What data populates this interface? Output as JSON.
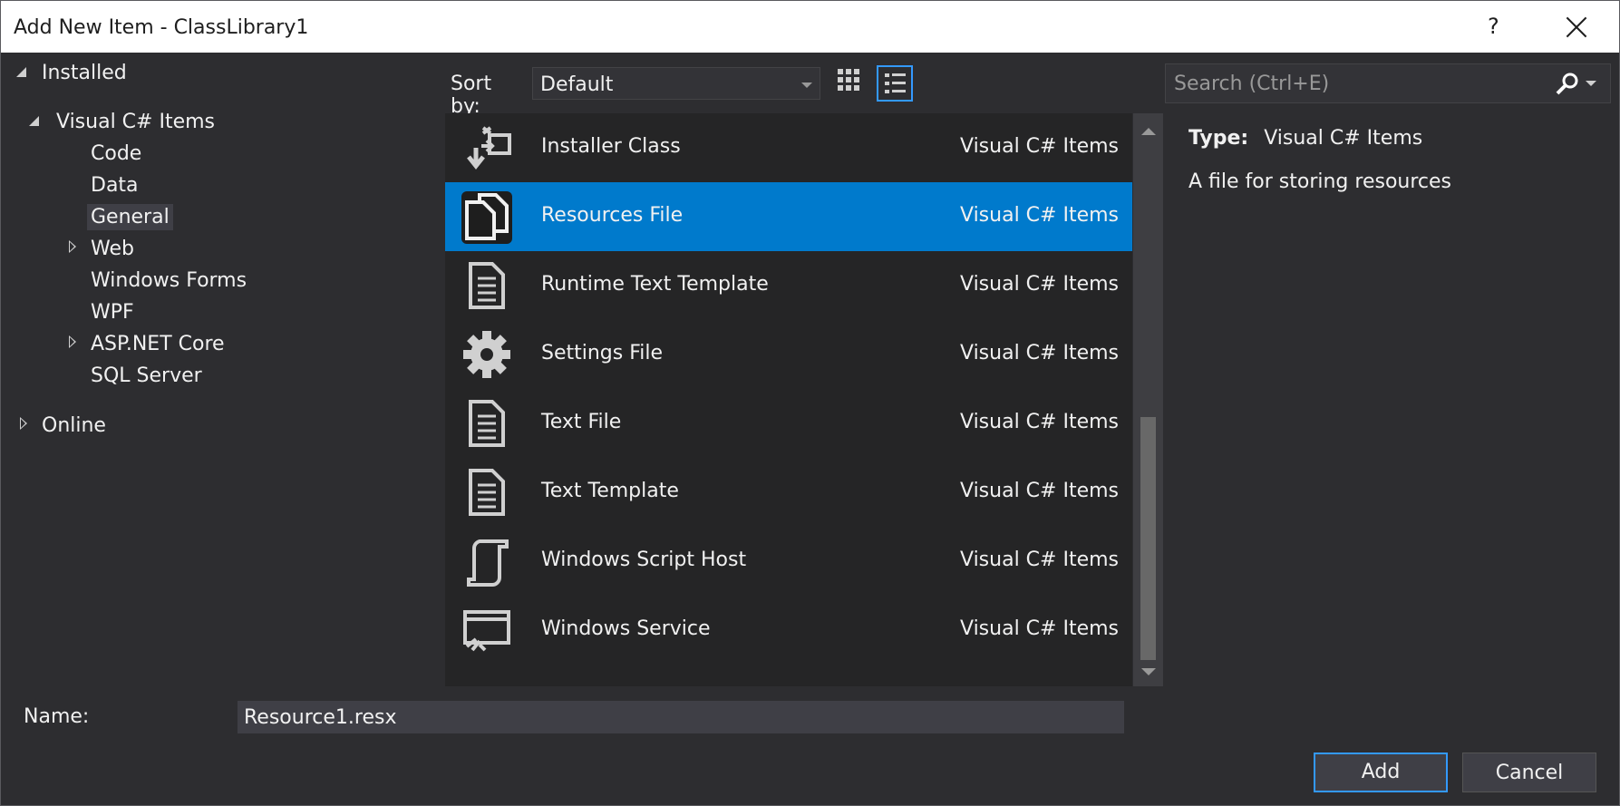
{
  "window": {
    "title": "Add New Item - ClassLibrary1",
    "help_label": "?"
  },
  "tree": {
    "installed": "Installed",
    "visual_csharp": "Visual C# Items",
    "children": [
      "Code",
      "Data",
      "General",
      "Web",
      "Windows Forms",
      "WPF",
      "ASP.NET Core",
      "SQL Server"
    ],
    "selected": "General",
    "online": "Online"
  },
  "sort": {
    "label": "Sort by:",
    "value": "Default"
  },
  "search": {
    "placeholder": "Search (Ctrl+E)"
  },
  "items": [
    {
      "name": "Installer Class",
      "category": "Visual C# Items",
      "icon": "installer-icon"
    },
    {
      "name": "Resources File",
      "category": "Visual C# Items",
      "icon": "resources-file-icon"
    },
    {
      "name": "Runtime Text Template",
      "category": "Visual C# Items",
      "icon": "text-template-icon"
    },
    {
      "name": "Settings File",
      "category": "Visual C# Items",
      "icon": "gear-icon"
    },
    {
      "name": "Text File",
      "category": "Visual C# Items",
      "icon": "text-file-icon"
    },
    {
      "name": "Text Template",
      "category": "Visual C# Items",
      "icon": "text-template-icon"
    },
    {
      "name": "Windows Script Host",
      "category": "Visual C# Items",
      "icon": "script-icon"
    },
    {
      "name": "Windows Service",
      "category": "Visual C# Items",
      "icon": "service-icon"
    }
  ],
  "selected_item": "Resources File",
  "details": {
    "type_label": "Type:",
    "type_value": "Visual C# Items",
    "description": "A file for storing resources"
  },
  "name_field": {
    "label": "Name:",
    "value": "Resource1.resx"
  },
  "buttons": {
    "add": "Add",
    "cancel": "Cancel"
  },
  "colors": {
    "accent": "#007acc",
    "background": "#2d2d30",
    "list_background": "#252526"
  }
}
